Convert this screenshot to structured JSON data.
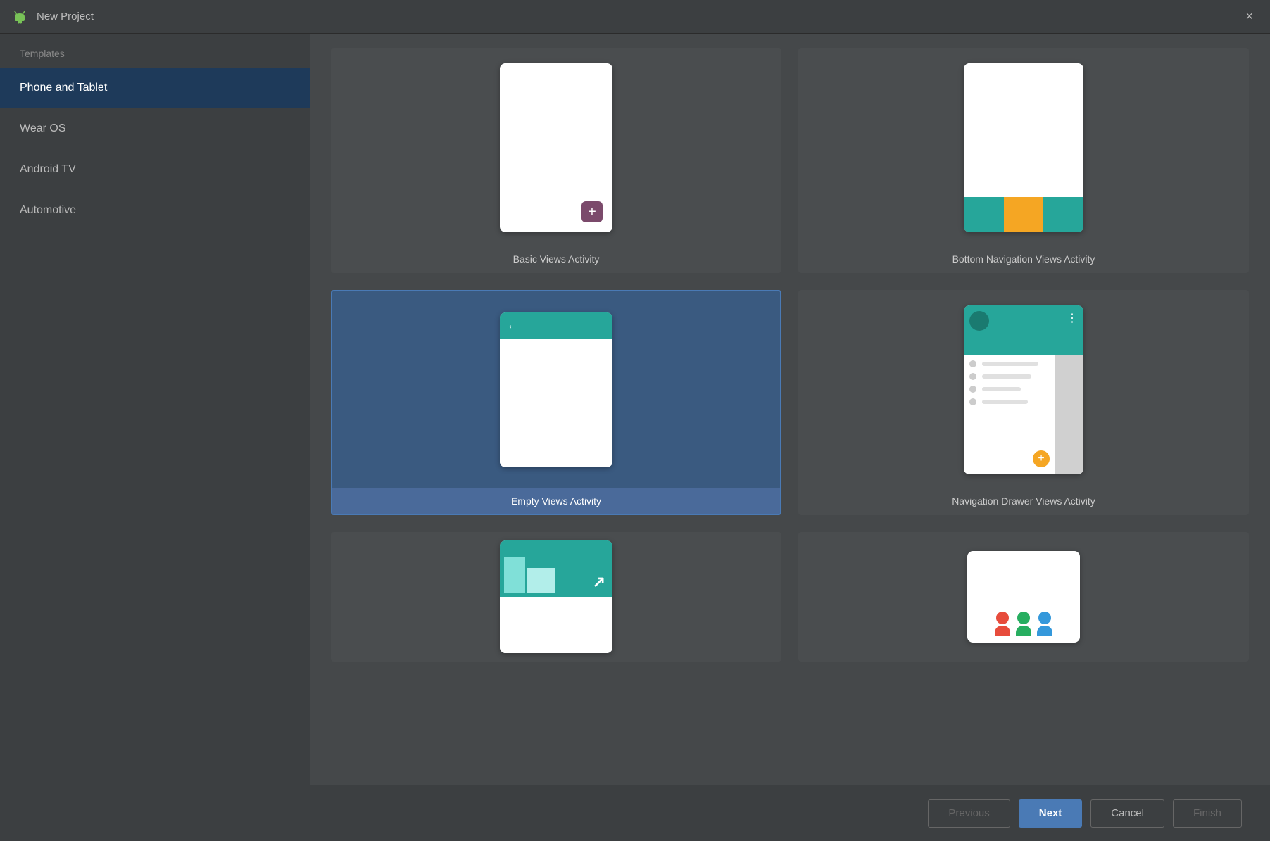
{
  "window": {
    "title": "New Project",
    "close_label": "×"
  },
  "sidebar": {
    "header": "Templates",
    "items": [
      {
        "id": "phone-tablet",
        "label": "Phone and Tablet",
        "active": true
      },
      {
        "id": "wear-os",
        "label": "Wear OS",
        "active": false
      },
      {
        "id": "android-tv",
        "label": "Android TV",
        "active": false
      },
      {
        "id": "automotive",
        "label": "Automotive",
        "active": false
      }
    ]
  },
  "templates": [
    {
      "id": "basic-views",
      "label": "Basic Views Activity",
      "selected": false
    },
    {
      "id": "bottom-nav",
      "label": "Bottom Navigation Views Activity",
      "selected": false
    },
    {
      "id": "empty-views",
      "label": "Empty Views Activity",
      "selected": true
    },
    {
      "id": "nav-drawer",
      "label": "Navigation Drawer Views Activity",
      "selected": false
    }
  ],
  "buttons": {
    "previous": "Previous",
    "next": "Next",
    "cancel": "Cancel",
    "finish": "Finish"
  },
  "colors": {
    "teal": "#26a69a",
    "gold": "#f5a623",
    "selected_border": "#4a7ab5"
  }
}
